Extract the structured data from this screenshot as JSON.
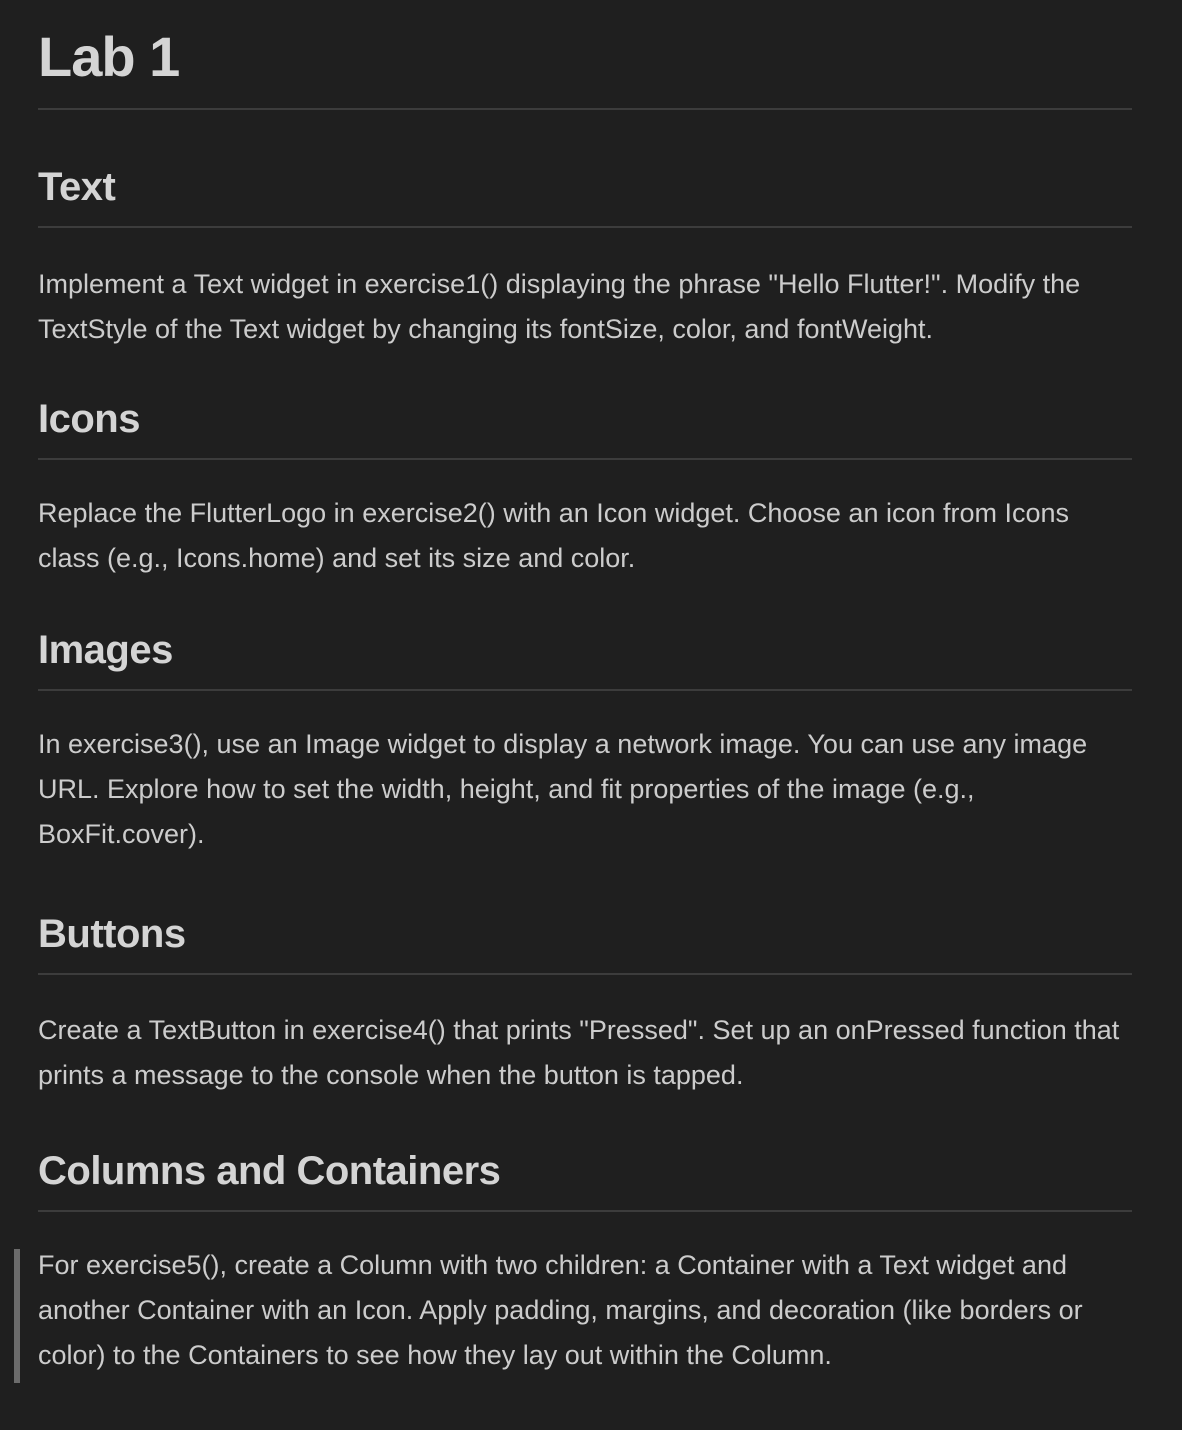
{
  "title": "Lab 1",
  "sections": [
    {
      "heading": "Text",
      "body": "Implement a Text widget in exercise1() displaying the phrase \"Hello Flutter!\". Modify the TextStyle of the Text widget by changing its fontSize, color, and fontWeight."
    },
    {
      "heading": "Icons",
      "body": "Replace the FlutterLogo in exercise2() with an Icon widget. Choose an icon from Icons class (e.g., Icons.home) and set its size and color."
    },
    {
      "heading": "Images",
      "body": "In exercise3(), use an Image widget to display a network image. You can use any image URL. Explore how to set the width, height, and fit properties of the image (e.g., BoxFit.cover)."
    },
    {
      "heading": "Buttons",
      "body": "Create a TextButton in exercise4() that prints \"Pressed\". Set up an onPressed function that prints a message to the console when the button is tapped."
    },
    {
      "heading": "Columns and Containers",
      "body": "For exercise5(), create a Column with two children: a Container with a Text widget and another Container with an Icon. Apply padding, margins, and decoration (like borders or color) to the Containers to see how they lay out within the Column."
    }
  ]
}
